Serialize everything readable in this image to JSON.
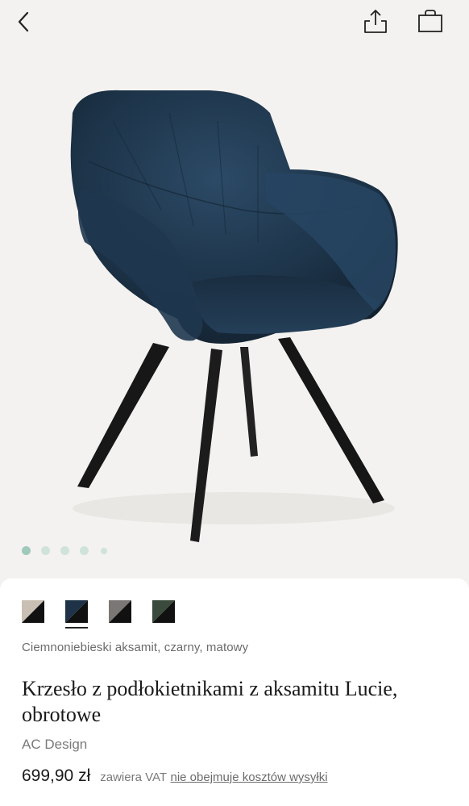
{
  "header": {
    "back_icon": "chevron-left-icon",
    "share_icon": "share-icon",
    "bag_icon": "shopping-bag-icon"
  },
  "gallery": {
    "image_count": 5,
    "active_index": 0,
    "dot_color": "#cfe3dc",
    "dot_active_color": "#9ec9bb"
  },
  "product": {
    "swatches": [
      {
        "name": "beige",
        "color": "#c9bfb3",
        "selected": false
      },
      {
        "name": "dark-blue",
        "color": "#1e3347",
        "selected": true
      },
      {
        "name": "grey",
        "color": "#7a7775",
        "selected": false
      },
      {
        "name": "dark-green",
        "color": "#3a4a3c",
        "selected": false
      }
    ],
    "variant_label": "Ciemnoniebieski aksamit, czarny, matowy",
    "title": "Krzesło z podłokietnikami z aksamitu Lucie, obrotowe",
    "brand": "AC Design",
    "price": "699,90 zł",
    "vat_note": "zawiera VAT",
    "shipping_link": "nie obejmuje kosztów wysyłki"
  }
}
